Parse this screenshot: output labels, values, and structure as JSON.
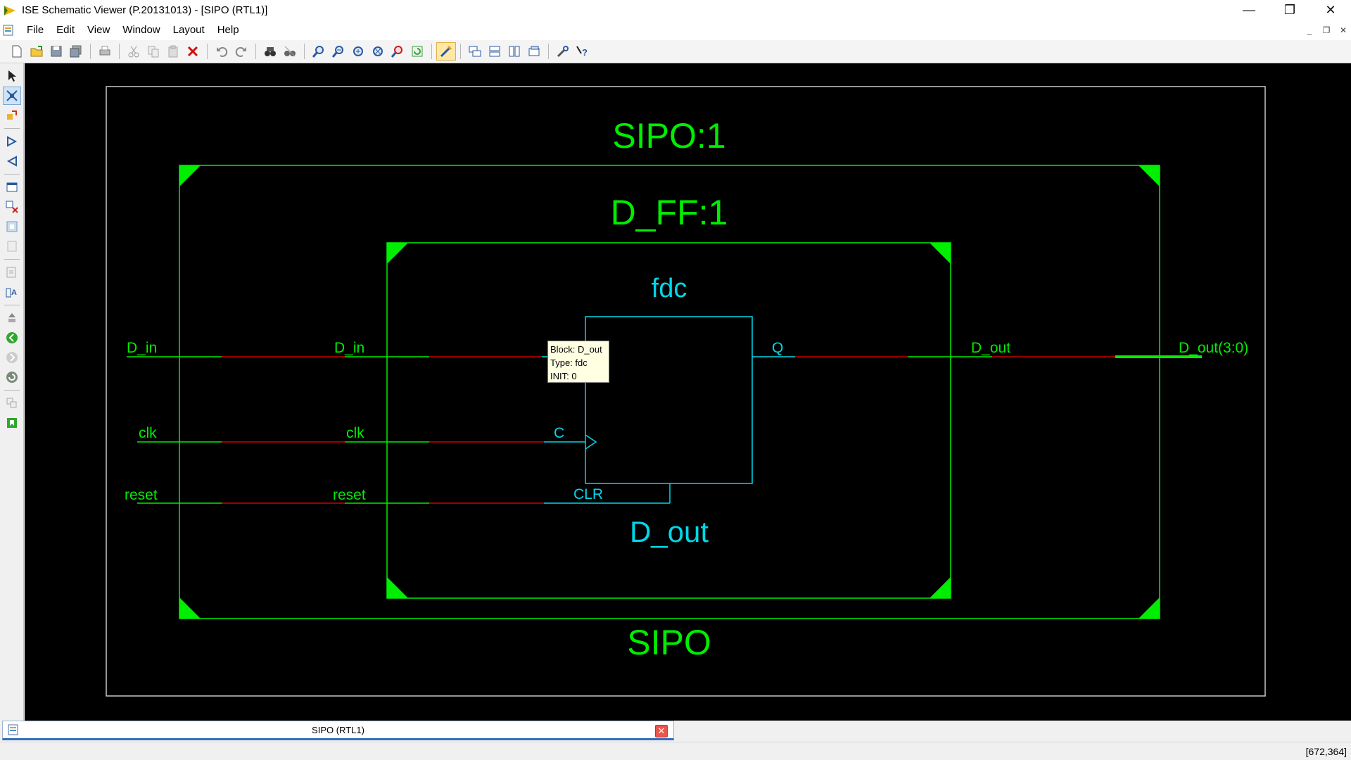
{
  "window": {
    "title": "ISE Schematic Viewer (P.20131013) - [SIPO (RTL1)]",
    "controls": {
      "minimize": "—",
      "restore": "❐",
      "close": "✕"
    }
  },
  "menu": [
    {
      "label": "File"
    },
    {
      "label": "Edit"
    },
    {
      "label": "View"
    },
    {
      "label": "Window"
    },
    {
      "label": "Layout"
    },
    {
      "label": "Help"
    }
  ],
  "mdi": {
    "minimize": "_",
    "restore": "❐",
    "close": "✕"
  },
  "toolbar_icons": [
    "new-icon",
    "open-icon",
    "save-icon",
    "save-all-icon",
    "print-icon",
    "cut-icon",
    "copy-icon",
    "paste-icon",
    "delete-icon",
    "undo-icon",
    "redo-icon",
    "find-icon",
    "find-next-icon",
    "zoom-in-icon",
    "zoom-out-icon",
    "zoom-full-icon",
    "zoom-fit-icon",
    "zoom-select-icon",
    "refresh-icon",
    "select-mode-icon",
    "cascade-icon",
    "tile-horizontal-icon",
    "tile-vertical-icon",
    "arrange-icon",
    "properties-icon",
    "help-icon"
  ],
  "left_toolbar_icons": [
    "select-arrow-icon",
    "route-icon",
    "expand-icon",
    "forward-icon",
    "back-icon",
    "add-window-icon",
    "remove-icon",
    "fit-icon",
    "disabled-icon",
    "edit-icon",
    "text-icon",
    "push-icon",
    "go-back-icon",
    "go-forward-icon",
    "refresh-icon",
    "copy-icon",
    "export-icon"
  ],
  "schematic": {
    "outer_title": "SIPO:1",
    "inner_title": "D_FF:1",
    "cell_type": "fdc",
    "instance_name": "D_out",
    "bottom_title": "SIPO",
    "outer_ports": {
      "d_in": "D_in",
      "clk": "clk",
      "reset": "reset",
      "d_out": "D_out(3:0)"
    },
    "inner_ports": {
      "d_in": "D_in",
      "clk": "clk",
      "reset": "reset",
      "d_out": "D_out"
    },
    "cell_pins": {
      "q": "Q",
      "c": "C",
      "clr": "CLR"
    },
    "colors": {
      "module": "#00ee00",
      "cell": "#00d8e8",
      "net_highlight": "#cc0000",
      "background": "#000000",
      "frame": "#c8c8c8"
    }
  },
  "tooltip": {
    "line1": "Block: D_out",
    "line2": "Type: fdc",
    "line3": "INIT: 0"
  },
  "tab": {
    "label": "SIPO (RTL1)",
    "close": "✕"
  },
  "status": {
    "coordinates": "[672,364]"
  }
}
